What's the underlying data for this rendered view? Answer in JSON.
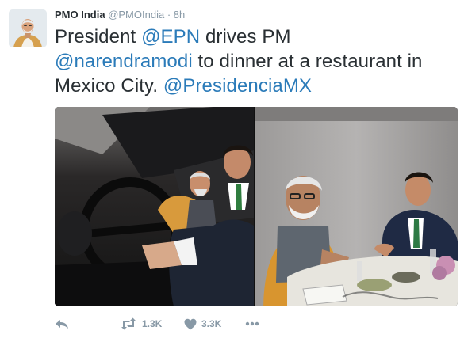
{
  "tweet": {
    "author_name": "PMO India",
    "author_handle": "@PMOIndia",
    "separator": "·",
    "time": "8h",
    "text": {
      "t1": "President ",
      "m1": "@EPN",
      "t2": " drives PM",
      "m2": "@narendramodi",
      "t3": " to dinner at a restaurant in Mexico City. ",
      "m3": "@PresidenciaMX"
    },
    "media": [
      {
        "icon": "photo-car"
      },
      {
        "icon": "photo-dinner"
      }
    ],
    "actions": {
      "retweet_count": "1.3K",
      "like_count": "3.3K"
    }
  },
  "colors": {
    "link": "#2b7bb9",
    "muted": "#8899a6",
    "text": "#292f33"
  }
}
